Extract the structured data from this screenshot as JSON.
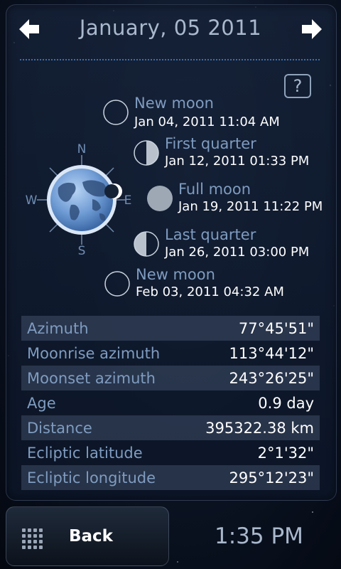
{
  "header": {
    "date_title": "January, 05 2011",
    "prev_icon": "arrow-left-icon",
    "next_icon": "arrow-right-icon",
    "help_label": "?"
  },
  "compass": {
    "north": "N",
    "south": "S",
    "east": "E",
    "west": "W"
  },
  "phases": [
    {
      "name": "New moon",
      "date": "Jan 04, 2011 11:04 AM",
      "phase": "new"
    },
    {
      "name": "First quarter",
      "date": "Jan 12, 2011 01:33 PM",
      "phase": "first-quarter"
    },
    {
      "name": "Full moon",
      "date": "Jan 19, 2011 11:22 PM",
      "phase": "full"
    },
    {
      "name": "Last quarter",
      "date": "Jan 26, 2011 03:00 PM",
      "phase": "last-quarter"
    },
    {
      "name": "New moon",
      "date": "Feb 03, 2011 04:32 AM",
      "phase": "new"
    }
  ],
  "details": [
    {
      "label": "Azimuth",
      "value": "77°45'51\""
    },
    {
      "label": "Moonrise azimuth",
      "value": "113°44'12\""
    },
    {
      "label": "Moonset azimuth",
      "value": "243°26'25\""
    },
    {
      "label": "Age",
      "value": "0.9 day"
    },
    {
      "label": "Distance",
      "value": "395322.38 km"
    },
    {
      "label": "Ecliptic latitude",
      "value": "2°1'32\""
    },
    {
      "label": "Ecliptic longitude",
      "value": "295°12'23\""
    }
  ],
  "footer": {
    "back_label": "Back",
    "menu_icon": "grid-menu-icon",
    "time": "1:35 PM"
  },
  "colors": {
    "accent_label": "#7f9cc0",
    "title": "#a9b8cc",
    "divider": "#3c6ea8"
  }
}
